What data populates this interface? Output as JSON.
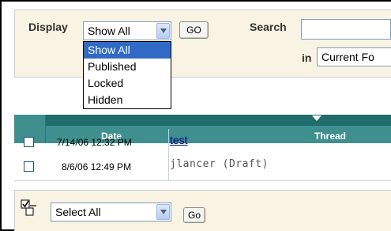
{
  "filter": {
    "display_label": "Display",
    "display_value": "Show All",
    "go_label": "GO",
    "search_label": "Search",
    "in_label": "in",
    "in_value": "Current Fo"
  },
  "display_options": [
    "Show All",
    "Published",
    "Locked",
    "Hidden"
  ],
  "table": {
    "headers": {
      "date": "Date",
      "thread": "Thread"
    },
    "rows": [
      {
        "date": "7/14/06 12:32 PM",
        "thread": "test",
        "is_link": true
      },
      {
        "date": "8/6/06 12:49 PM",
        "thread": "jlancer (Draft)",
        "is_link": false
      }
    ]
  },
  "bottom": {
    "select_value": "Select All",
    "go_label": "Go"
  },
  "colors": {
    "panel_bg": "#f8f3e2",
    "header_teal": "#3f8f8f",
    "header_dark_teal": "#1f6c6c",
    "selection_blue": "#316ac5",
    "link_color": "#00007f"
  }
}
